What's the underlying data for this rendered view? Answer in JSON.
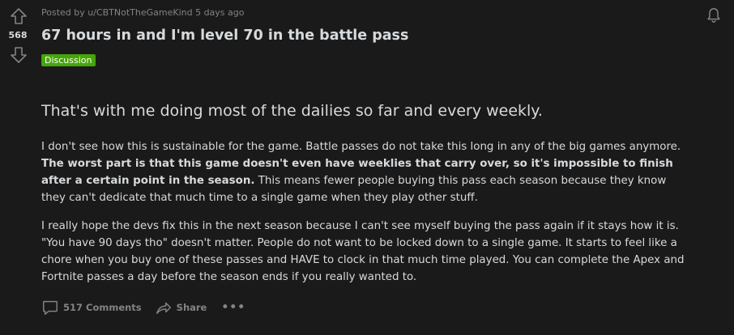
{
  "post": {
    "score": "568",
    "meta": "Posted by u/CBTNotTheGameKind 5 days ago",
    "title": "67 hours in and I'm level 70 in the battle pass",
    "flair": "Discussion",
    "lead": "That's with me doing most of the dailies so far and every weekly.",
    "paragraph1": {
      "part1": "I don't see how this is sustainable for the game. Battle passes do not take this long in any of the big games anymore. ",
      "bold": "The worst part is that this game doesn't even have weeklies that carry over, so it's impossible to finish after a certain point in the season.",
      "part2": " This means fewer people buying this pass each season because they know they can't dedicate that much time to a single game when they play other stuff."
    },
    "paragraph2": "I really hope the devs fix this in the next season because I can't see myself buying the pass again if it stays how it is. \"You have 90 days tho\" doesn't matter. People do not want to be locked down to a single game. It starts to feel like a chore when you buy one of these passes and HAVE to clock in that much time played. You can complete the Apex and Fortnite passes a day before the season ends if you really wanted to.",
    "actions": {
      "comments": "517 Comments",
      "share": "Share",
      "more": "•••"
    }
  },
  "icons": {
    "upvote": "arrow-up-outline-icon",
    "downvote": "arrow-down-outline-icon",
    "bell": "bell-icon",
    "comments": "speech-bubble-icon",
    "share": "share-arrow-icon"
  },
  "colors": {
    "background": "#1a1a1b",
    "text": "#d7dadc",
    "muted": "#818384",
    "flair": "#46a508"
  }
}
